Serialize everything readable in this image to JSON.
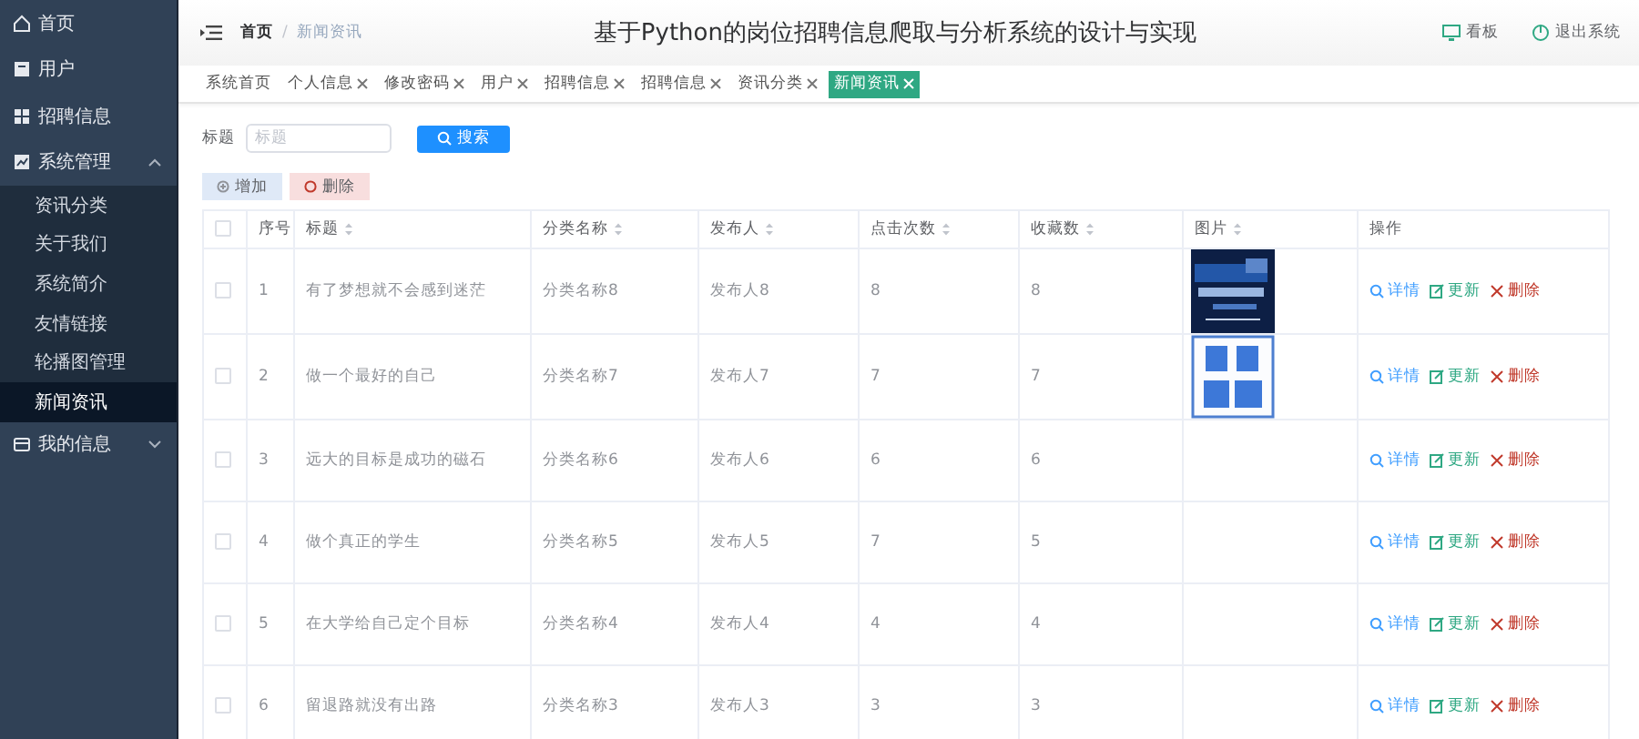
{
  "sidebar": {
    "items": [
      {
        "label": "首页",
        "kind": "link"
      },
      {
        "label": "用户",
        "kind": "link"
      },
      {
        "label": "招聘信息",
        "kind": "link"
      },
      {
        "label": "系统管理",
        "kind": "group",
        "expanded": true,
        "children": [
          {
            "label": "资讯分类",
            "selected": false
          },
          {
            "label": "关于我们",
            "selected": false
          },
          {
            "label": "系统简介",
            "selected": false
          },
          {
            "label": "友情链接",
            "selected": false
          },
          {
            "label": "轮播图管理",
            "selected": false
          },
          {
            "label": "新闻资讯",
            "selected": true
          }
        ]
      },
      {
        "label": "我的信息",
        "kind": "group",
        "expanded": false
      }
    ]
  },
  "header": {
    "breadcrumb": {
      "items": [
        "首页",
        "新闻资讯"
      ],
      "separator": "/"
    },
    "title": "基于Python的岗位招聘信息爬取与分析系统的设计与实现",
    "actions": [
      {
        "label": "看板",
        "kind": "dashboard"
      },
      {
        "label": "退出系统",
        "kind": "logout"
      }
    ]
  },
  "tabs": [
    {
      "label": "系统首页",
      "closable": false,
      "selected": false
    },
    {
      "label": "个人信息",
      "closable": true,
      "selected": false
    },
    {
      "label": "修改密码",
      "closable": true,
      "selected": false
    },
    {
      "label": "用户",
      "closable": true,
      "selected": false
    },
    {
      "label": "招聘信息",
      "closable": true,
      "selected": false
    },
    {
      "label": "招聘信息",
      "closable": true,
      "selected": false
    },
    {
      "label": "资讯分类",
      "closable": true,
      "selected": false
    },
    {
      "label": "新闻资讯",
      "closable": true,
      "selected": true
    }
  ],
  "search": {
    "label": "标题",
    "placeholder": "标题",
    "button": "搜索"
  },
  "toolbar": [
    {
      "label": "增加",
      "kind": "add"
    },
    {
      "label": "删除",
      "kind": "delete"
    }
  ],
  "table": {
    "all_checked": false,
    "columns": [
      {
        "label": "序号",
        "sortable": false
      },
      {
        "label": "标题",
        "sortable": true
      },
      {
        "label": "分类名称",
        "sortable": true
      },
      {
        "label": "发布人",
        "sortable": true
      },
      {
        "label": "点击次数",
        "sortable": true
      },
      {
        "label": "收藏数",
        "sortable": true
      },
      {
        "label": "图片",
        "sortable": true
      },
      {
        "label": "操作",
        "sortable": false
      }
    ],
    "rows": [
      {
        "checked": false,
        "cells": [
          "1",
          "有了梦想就不会感到迷茫",
          "分类名称8",
          "发布人8",
          "8",
          "8"
        ],
        "actions": [
          {
            "label": "详情",
            "kind": "detail"
          },
          {
            "label": "更新",
            "kind": "edit"
          },
          {
            "label": "删除",
            "kind": "delete"
          }
        ]
      },
      {
        "checked": false,
        "cells": [
          "2",
          "做一个最好的自己",
          "分类名称7",
          "发布人7",
          "7",
          "7"
        ],
        "actions": [
          {
            "label": "详情",
            "kind": "detail"
          },
          {
            "label": "更新",
            "kind": "edit"
          },
          {
            "label": "删除",
            "kind": "delete"
          }
        ]
      },
      {
        "checked": false,
        "cells": [
          "3",
          "远大的目标是成功的磁石",
          "分类名称6",
          "发布人6",
          "6",
          "6"
        ],
        "actions": [
          {
            "label": "详情",
            "kind": "detail"
          },
          {
            "label": "更新",
            "kind": "edit"
          },
          {
            "label": "删除",
            "kind": "delete"
          }
        ]
      },
      {
        "checked": false,
        "cells": [
          "4",
          "做个真正的学生",
          "分类名称5",
          "发布人5",
          "7",
          "5"
        ],
        "actions": [
          {
            "label": "详情",
            "kind": "detail"
          },
          {
            "label": "更新",
            "kind": "edit"
          },
          {
            "label": "删除",
            "kind": "delete"
          }
        ]
      },
      {
        "checked": false,
        "cells": [
          "5",
          "在大学给自己定个目标",
          "分类名称4",
          "发布人4",
          "4",
          "4"
        ],
        "actions": [
          {
            "label": "详情",
            "kind": "detail"
          },
          {
            "label": "更新",
            "kind": "edit"
          },
          {
            "label": "删除",
            "kind": "delete"
          }
        ]
      },
      {
        "checked": false,
        "cells": [
          "6",
          "留退路就没有出路",
          "分类名称3",
          "发布人3",
          "3",
          "3"
        ],
        "actions": [
          {
            "label": "详情",
            "kind": "detail"
          },
          {
            "label": "更新",
            "kind": "edit"
          },
          {
            "label": "删除",
            "kind": "delete"
          }
        ]
      }
    ]
  }
}
